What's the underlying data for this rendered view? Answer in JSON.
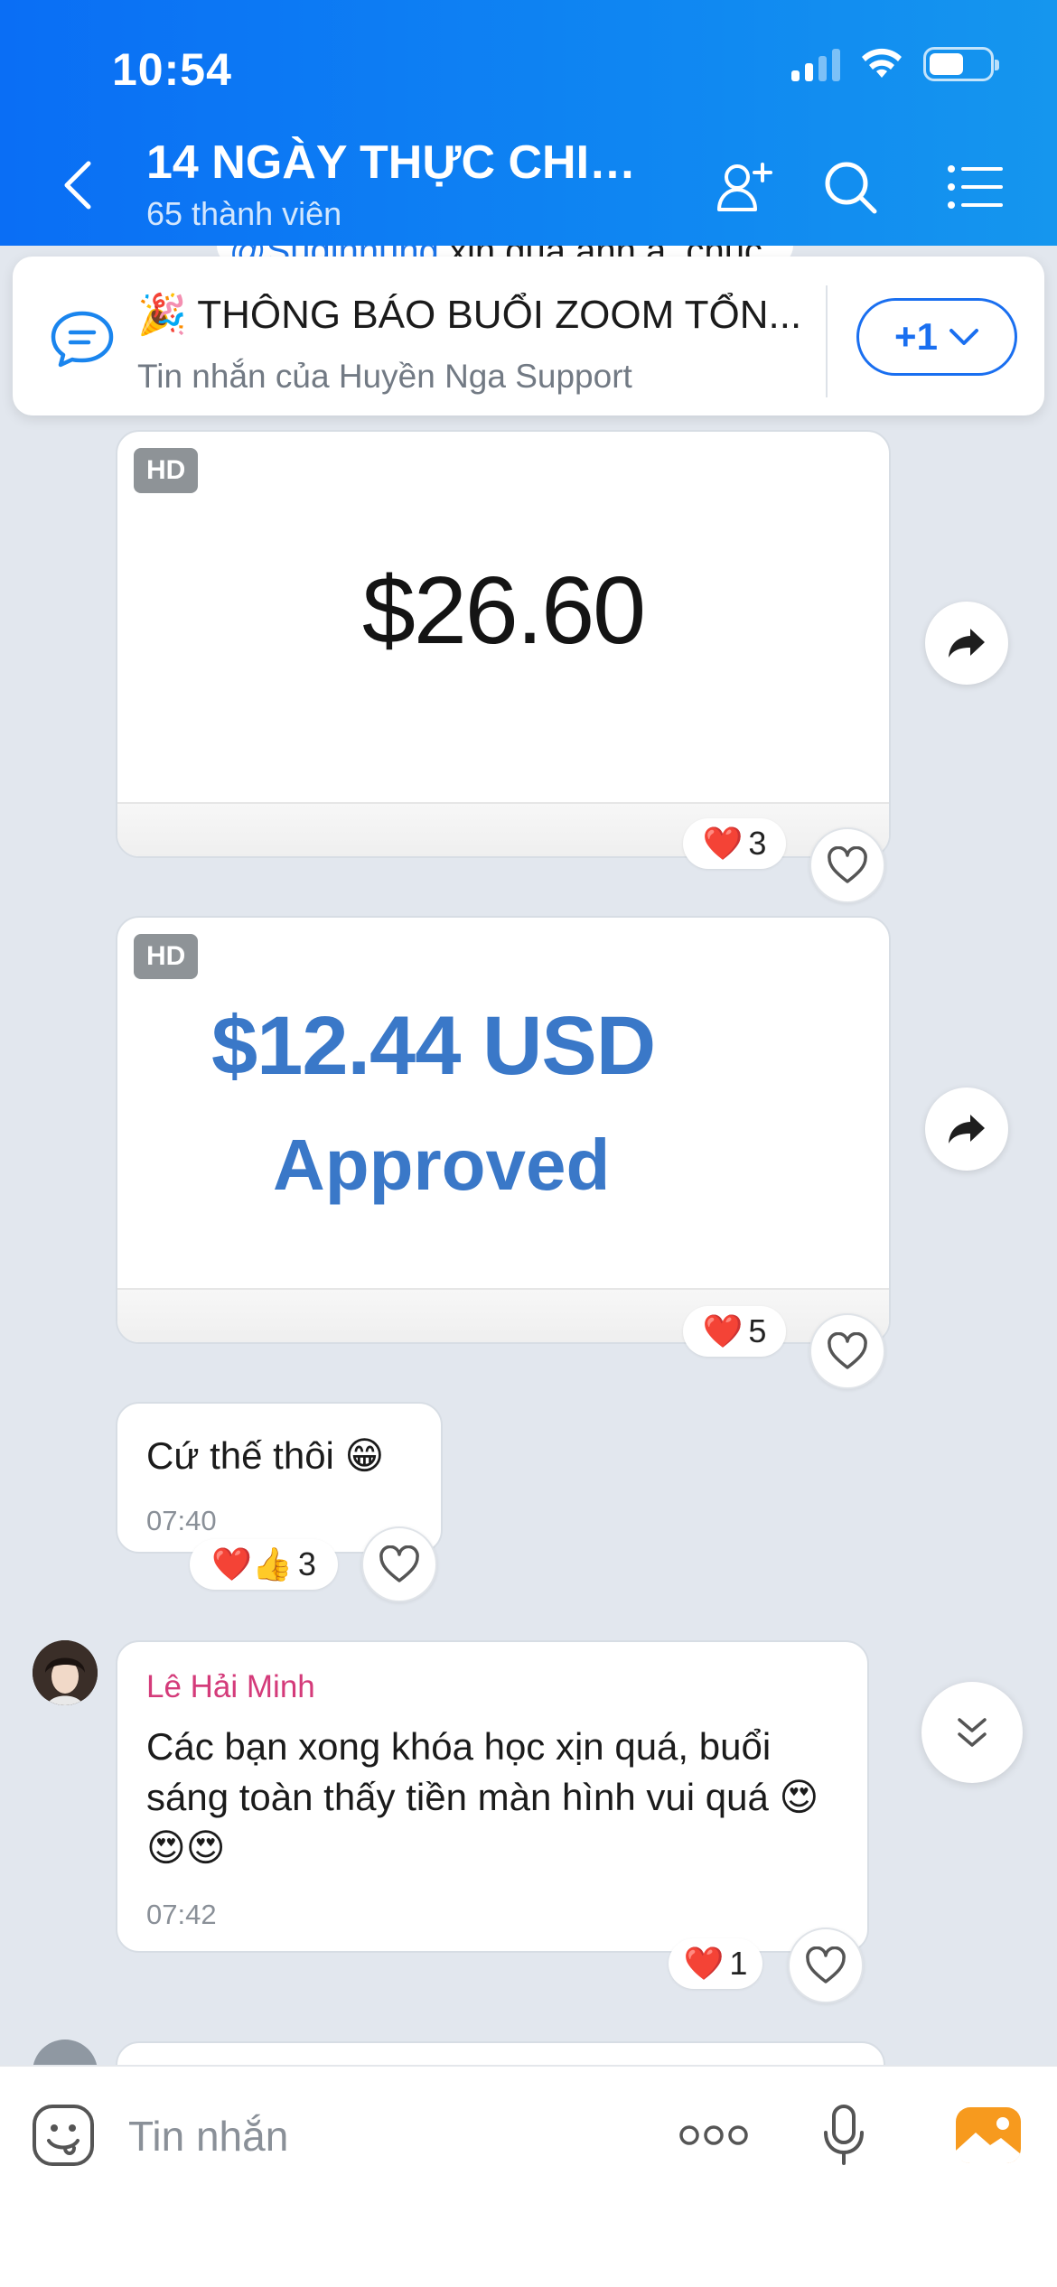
{
  "status_bar": {
    "time": "10:54"
  },
  "header": {
    "title": "14 NGÀY THỰC CHIẾ...",
    "subtitle": "65 thành viên"
  },
  "peek_message": {
    "mention": "@Sudinhung",
    "text": " xin quà anh ạ. chúc"
  },
  "pinned": {
    "title": "🎉 THÔNG BÁO BUỔI ZOOM TỔN...",
    "subtitle": "Tin nhắn của Huyền Nga Support",
    "more_label": "+1"
  },
  "messages": [
    {
      "type": "image",
      "hd": "HD",
      "content": "$26.60",
      "reactions": {
        "emoji": "❤️",
        "count": "3"
      }
    },
    {
      "type": "image",
      "hd": "HD",
      "amount": "$12.44 USD",
      "status": "Approved",
      "reactions": {
        "emoji": "❤️",
        "count": "5"
      }
    },
    {
      "type": "text",
      "text": "Cứ thế thôi 😁",
      "time": "07:40",
      "reactions": {
        "emoji": "❤️👍",
        "count": "3"
      }
    },
    {
      "type": "text",
      "sender": "Lê Hải Minh",
      "text": "Các bạn xong khóa học xịn quá, buổi sáng toàn thấy tiền màn hình vui quá 😍😍😍",
      "time": "07:42",
      "reactions": {
        "emoji": "❤️",
        "count": "1"
      }
    }
  ],
  "input": {
    "placeholder": "Tin nhắn"
  },
  "icons": {
    "back": "chevron-left-icon",
    "add_member": "add-user-icon",
    "search": "search-icon",
    "menu": "list-icon",
    "pin": "chat-bubble-icon",
    "share": "share-arrow-icon",
    "heart": "heart-outline-icon",
    "sticker": "sticker-icon",
    "more": "more-dots-icon",
    "mic": "microphone-icon",
    "gallery": "image-gallery-icon",
    "scroll_down": "double-chevron-down-icon"
  },
  "colors": {
    "header": "#0a6ef5",
    "accent": "#1a6ff0",
    "sender": "#d43b7a",
    "chat_bg": "#e2e7ee"
  }
}
